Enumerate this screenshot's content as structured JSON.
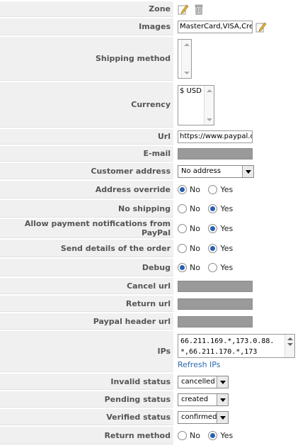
{
  "fields": {
    "zone": {
      "label": "Zone"
    },
    "images": {
      "label": "Images",
      "value": "MasterCard,VISA,Cred"
    },
    "shipping_method": {
      "label": "Shipping method"
    },
    "currency": {
      "label": "Currency",
      "options": [
        "$ USD"
      ]
    },
    "url": {
      "label": "Url",
      "value": "https://www.paypal.cor"
    },
    "email": {
      "label": "E-mail"
    },
    "customer_address": {
      "label": "Customer address",
      "value": "No address"
    },
    "address_override": {
      "label": "Address override",
      "selected": "No"
    },
    "no_shipping": {
      "label": "No shipping",
      "selected": "Yes"
    },
    "allow_notifications": {
      "label": "Allow payment notifications from PayPal",
      "selected": "Yes"
    },
    "send_details": {
      "label": "Send details of the order",
      "selected": "Yes"
    },
    "debug": {
      "label": "Debug",
      "selected": "No"
    },
    "cancel_url": {
      "label": "Cancel url"
    },
    "return_url": {
      "label": "Return url"
    },
    "paypal_header_url": {
      "label": "Paypal header url"
    },
    "ips": {
      "label": "IPs",
      "value": "66.211.169.*,173.0.88.*,66.211.170.*,173",
      "refresh_label": "Refresh IPs"
    },
    "invalid_status": {
      "label": "Invalid status",
      "value": "cancelled"
    },
    "pending_status": {
      "label": "Pending status",
      "value": "created"
    },
    "verified_status": {
      "label": "Verified status",
      "value": "confirmed"
    },
    "return_method": {
      "label": "Return method",
      "selected": "Yes"
    }
  },
  "radio_labels": {
    "no": "No",
    "yes": "Yes"
  },
  "icons": {
    "edit": "edit-pencil-icon",
    "trash": "trash-icon"
  },
  "colors": {
    "label_bg": "#f0f0f0",
    "link": "#2a69b0",
    "radio_on": "#2a5fb0",
    "masked": "#9a9a9a"
  }
}
